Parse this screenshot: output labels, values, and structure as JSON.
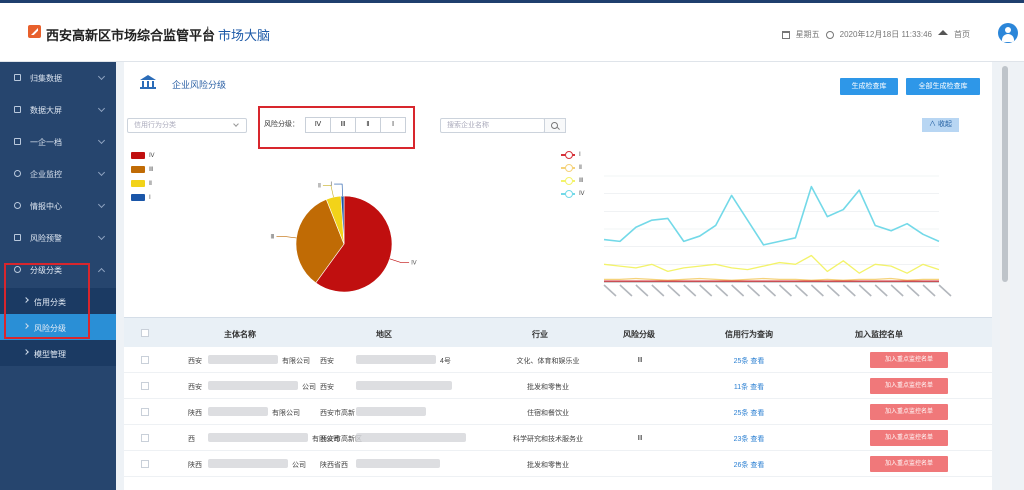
{
  "header": {
    "app_title": "西安高新区市场综合监管平台",
    "separator": "|",
    "subtitle": "市场大脑",
    "weekday": "星期五",
    "datetime": "2020年12月18日 11:33:46",
    "home_label": "首页"
  },
  "sidebar": {
    "items": [
      {
        "label": "归集数据",
        "icon": "edit-icon"
      },
      {
        "label": "数据大屏",
        "icon": "grid-icon"
      },
      {
        "label": "一企一档",
        "icon": "file-icon"
      },
      {
        "label": "企业监控",
        "icon": "eye-icon"
      },
      {
        "label": "情报中心",
        "icon": "info-icon"
      },
      {
        "label": "风险预警",
        "icon": "shield-icon"
      },
      {
        "label": "分级分类",
        "icon": "star-icon"
      }
    ],
    "subitems": [
      {
        "label": "信用分类"
      },
      {
        "label": "风险分级"
      },
      {
        "label": "模型管理"
      }
    ]
  },
  "panel": {
    "title": "企业风险分级",
    "btn_generate": "生成检查库",
    "btn_generate_all": "全部生成检查库",
    "select_placeholder": "信用行为分类",
    "risk_filter_label": "风险分级：",
    "risk_levels": [
      "Ⅳ",
      "Ⅲ",
      "Ⅱ",
      "Ⅰ"
    ],
    "search_placeholder": "搜索企业名称",
    "collapse_label": "收起"
  },
  "pie_legend": [
    {
      "label": "Ⅳ",
      "color": "#c00f0f"
    },
    {
      "label": "Ⅲ",
      "color": "#c06b05"
    },
    {
      "label": "Ⅱ",
      "color": "#f2d319"
    },
    {
      "label": "Ⅰ",
      "color": "#1a56a8"
    }
  ],
  "line_legend": [
    {
      "label": "Ⅰ",
      "color": "#d6323a"
    },
    {
      "label": "Ⅱ",
      "color": "#f5d27a"
    },
    {
      "label": "Ⅲ",
      "color": "#f3f36a"
    },
    {
      "label": "Ⅳ",
      "color": "#73d9e8"
    }
  ],
  "chart_data": [
    {
      "type": "pie",
      "slices": [
        {
          "label": "Ⅳ",
          "value": 60,
          "color": "#c00f0f"
        },
        {
          "label": "Ⅲ",
          "value": 34,
          "color": "#c06b05"
        },
        {
          "label": "Ⅱ",
          "value": 5,
          "color": "#f2d319"
        },
        {
          "label": "Ⅰ",
          "value": 1,
          "color": "#1a56a8"
        }
      ]
    },
    {
      "type": "line",
      "x_count": 22,
      "ylim": [
        0,
        120
      ],
      "series": [
        {
          "name": "Ⅳ",
          "color": "#73d9e8",
          "values": [
            48,
            46,
            62,
            70,
            72,
            46,
            52,
            64,
            98,
            70,
            42,
            46,
            50,
            108,
            74,
            82,
            104,
            64,
            58,
            66,
            54,
            46
          ]
        },
        {
          "name": "Ⅲ",
          "color": "#f3f36a",
          "values": [
            20,
            18,
            16,
            20,
            12,
            16,
            18,
            20,
            16,
            14,
            18,
            22,
            20,
            30,
            12,
            24,
            10,
            20,
            18,
            10,
            20,
            14
          ]
        },
        {
          "name": "Ⅱ",
          "color": "#f5d27a",
          "values": [
            3,
            3,
            4,
            3,
            2,
            3,
            4,
            3,
            2,
            3,
            4,
            3,
            3,
            2,
            3,
            2,
            3,
            3,
            4,
            2,
            3,
            3
          ]
        },
        {
          "name": "Ⅰ",
          "color": "#d6323a",
          "values": [
            1,
            1,
            1,
            1,
            1,
            1,
            1,
            1,
            1,
            1,
            1,
            1,
            1,
            1,
            1,
            1,
            1,
            1,
            1,
            1,
            1,
            1
          ]
        }
      ]
    }
  ],
  "table": {
    "headers": [
      "主体名称",
      "地区",
      "行业",
      "风险分级",
      "信用行为查询",
      "加入监控名单"
    ],
    "rows": [
      {
        "name_prefix": "西安",
        "name_suffix": "有限公司",
        "region_prefix": "西安",
        "region_suffix": "4号",
        "industry": "文化、体育和娱乐业",
        "risk": "Ⅲ",
        "credit_query": "25条 查看",
        "action": "加入重点监控名单"
      },
      {
        "name_prefix": "西安",
        "name_suffix": "公司",
        "region_prefix": "西安",
        "region_suffix": "",
        "industry": "批发和零售业",
        "risk": "",
        "credit_query": "11条 查看",
        "action": "加入重点监控名单"
      },
      {
        "name_prefix": "陕西",
        "name_suffix": "有限公司",
        "region_prefix": "西安市高新",
        "region_suffix": "",
        "industry": "住宿和餐饮业",
        "risk": "",
        "credit_query": "25条 查看",
        "action": "加入重点监控名单"
      },
      {
        "name_prefix": "西",
        "name_suffix": "有限公司",
        "region_prefix": "西安市高新区",
        "region_suffix": "",
        "industry": "科学研究和技术服务业",
        "risk": "Ⅲ",
        "credit_query": "23条 查看",
        "action": "加入重点监控名单"
      },
      {
        "name_prefix": "陕西",
        "name_suffix": "公司",
        "region_prefix": "陕西省西",
        "region_suffix": "",
        "industry": "批发和零售业",
        "risk": "",
        "credit_query": "26条 查看",
        "action": "加入重点监控名单"
      }
    ]
  }
}
